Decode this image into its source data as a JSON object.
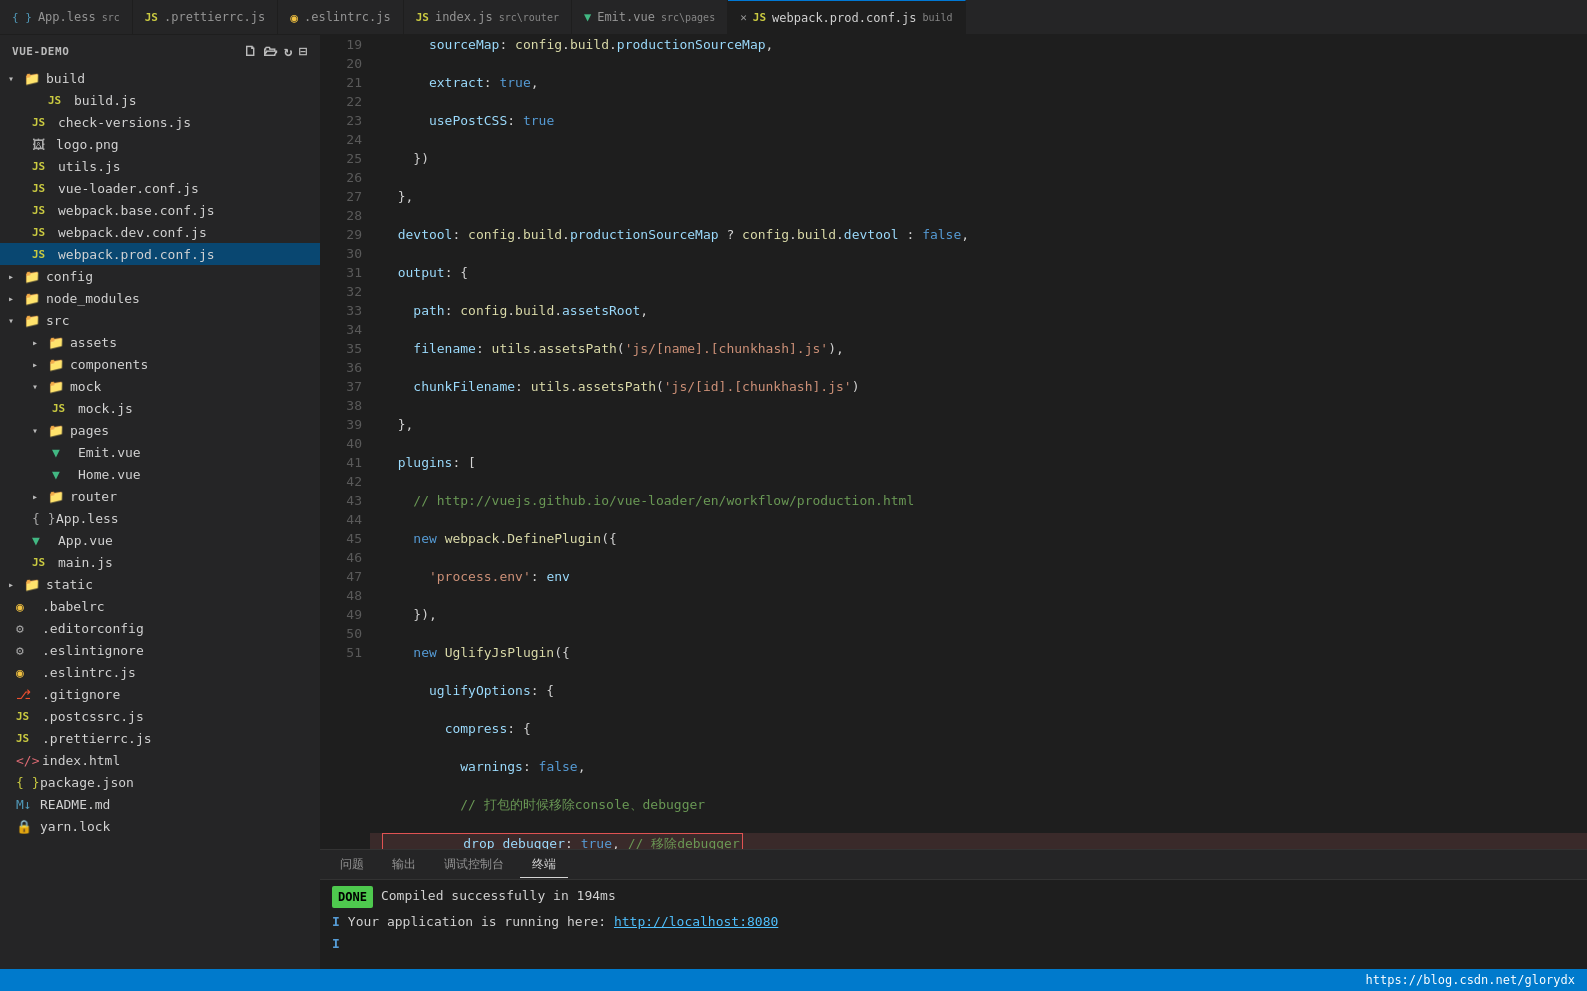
{
  "tabs": [
    {
      "id": "tab1",
      "icon": "css",
      "name": "App.less",
      "badge": "src",
      "active": false,
      "closable": false
    },
    {
      "id": "tab2",
      "icon": "js",
      "name": ".prettierrc.js",
      "badge": "",
      "active": false,
      "closable": false
    },
    {
      "id": "tab3",
      "icon": "dot",
      "name": ".eslintrc.js",
      "badge": "",
      "active": false,
      "closable": false
    },
    {
      "id": "tab4",
      "icon": "js",
      "name": "index.js",
      "badge": "src\\router",
      "active": false,
      "closable": false
    },
    {
      "id": "tab5",
      "icon": "vue",
      "name": "Emit.vue",
      "badge": "src\\pages",
      "active": false,
      "closable": false
    },
    {
      "id": "tab6",
      "icon": "js",
      "name": "webpack.prod.conf.js",
      "badge": "build",
      "active": true,
      "closable": true
    }
  ],
  "explorer": {
    "title": "VUE-DEMO",
    "tree": [
      {
        "id": "build",
        "type": "folder",
        "name": "build",
        "depth": 0,
        "expanded": true
      },
      {
        "id": "build.js",
        "type": "js",
        "name": "build.js",
        "depth": 1
      },
      {
        "id": "check-versions.js",
        "type": "js",
        "name": "check-versions.js",
        "depth": 1
      },
      {
        "id": "logo.png",
        "type": "img",
        "name": "logo.png",
        "depth": 1
      },
      {
        "id": "utils.js",
        "type": "js",
        "name": "utils.js",
        "depth": 1
      },
      {
        "id": "vue-loader.conf.js",
        "type": "js",
        "name": "vue-loader.conf.js",
        "depth": 1
      },
      {
        "id": "webpack.base.conf.js",
        "type": "js",
        "name": "webpack.base.conf.js",
        "depth": 1
      },
      {
        "id": "webpack.dev.conf.js",
        "type": "js",
        "name": "webpack.dev.conf.js",
        "depth": 1
      },
      {
        "id": "webpack.prod.conf.js",
        "type": "js",
        "name": "webpack.prod.conf.js",
        "depth": 1,
        "selected": true
      },
      {
        "id": "config",
        "type": "folder",
        "name": "config",
        "depth": 0,
        "expanded": false
      },
      {
        "id": "node_modules",
        "type": "folder",
        "name": "node_modules",
        "depth": 0,
        "expanded": false
      },
      {
        "id": "src",
        "type": "folder",
        "name": "src",
        "depth": 0,
        "expanded": true
      },
      {
        "id": "assets",
        "type": "folder",
        "name": "assets",
        "depth": 1,
        "expanded": false
      },
      {
        "id": "components",
        "type": "folder",
        "name": "components",
        "depth": 1,
        "expanded": false
      },
      {
        "id": "mock",
        "type": "folder",
        "name": "mock",
        "depth": 1,
        "expanded": true
      },
      {
        "id": "mock.js",
        "type": "js",
        "name": "mock.js",
        "depth": 2
      },
      {
        "id": "pages",
        "type": "folder",
        "name": "pages",
        "depth": 1,
        "expanded": true
      },
      {
        "id": "Emit.vue",
        "type": "vue",
        "name": "Emit.vue",
        "depth": 2
      },
      {
        "id": "Home.vue",
        "type": "vue",
        "name": "Home.vue",
        "depth": 2
      },
      {
        "id": "router",
        "type": "folder",
        "name": "router",
        "depth": 1,
        "expanded": false
      },
      {
        "id": "App.less",
        "type": "css",
        "name": "App.less",
        "depth": 1
      },
      {
        "id": "App.vue",
        "type": "vue",
        "name": "App.vue",
        "depth": 1
      },
      {
        "id": "main.js",
        "type": "js",
        "name": "main.js",
        "depth": 1
      },
      {
        "id": "static",
        "type": "folder",
        "name": "static",
        "depth": 0,
        "expanded": false
      },
      {
        "id": ".babelrc",
        "type": "dot",
        "name": ".babelrc",
        "depth": 0
      },
      {
        "id": ".editorconfig",
        "type": "gear",
        "name": ".editorconfig",
        "depth": 0
      },
      {
        "id": ".eslintignore",
        "type": "gear",
        "name": ".eslintignore",
        "depth": 0
      },
      {
        "id": ".eslintrc.js",
        "type": "dot",
        "name": ".eslintrc.js",
        "depth": 0
      },
      {
        "id": ".gitignore",
        "type": "git",
        "name": ".gitignore",
        "depth": 0
      },
      {
        "id": ".postcssrc.js",
        "type": "js",
        "name": ".postcssrc.js",
        "depth": 0
      },
      {
        "id": ".prettierrc.js",
        "type": "js",
        "name": ".prettierrc.js",
        "depth": 0
      },
      {
        "id": "index.html",
        "type": "html",
        "name": "index.html",
        "depth": 0
      },
      {
        "id": "package.json",
        "type": "json",
        "name": "package.json",
        "depth": 0
      },
      {
        "id": "README.md",
        "type": "md",
        "name": "README.md",
        "depth": 0
      },
      {
        "id": "yarn.lock",
        "type": "lock",
        "name": "yarn.lock",
        "depth": 0
      }
    ]
  },
  "terminal": {
    "tabs": [
      "问题",
      "输出",
      "调试控制台",
      "终端"
    ],
    "active_tab": "终端",
    "done_text": "DONE",
    "compile_text": "Compiled successfully in 194ms",
    "run_text": "Your application is running here: http://localhost:8080"
  },
  "status_bar": {
    "url": "https://blog.csdn.net/glorydx"
  }
}
